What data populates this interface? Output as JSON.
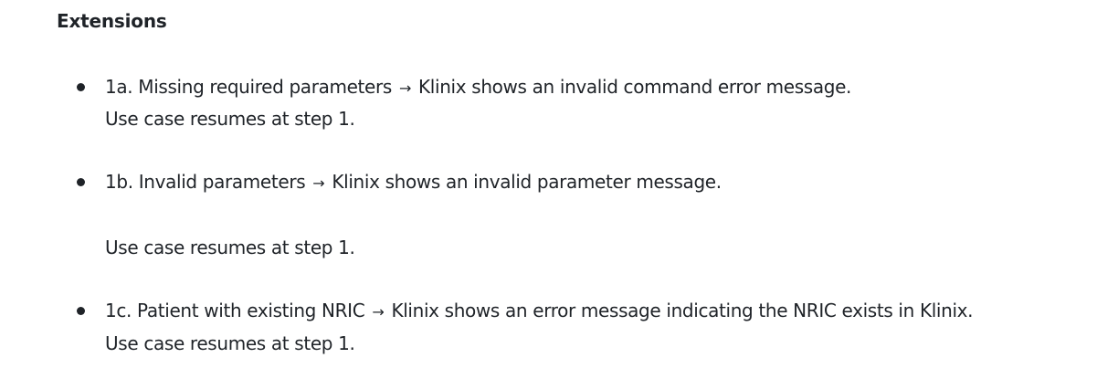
{
  "section": {
    "heading": "Extensions"
  },
  "extensions": [
    {
      "id": "1a",
      "lead": "1a. Missing required parameters",
      "arrow": "→",
      "result": "Klinix shows an invalid command error message.",
      "resume": "Use case resumes at step 1."
    },
    {
      "id": "1b",
      "lead": "1b. Invalid parameters",
      "arrow": "→",
      "result": "Klinix shows an invalid parameter message.",
      "resume": "Use case resumes at step 1."
    },
    {
      "id": "1c",
      "lead": "1c. Patient with existing NRIC",
      "arrow": "→",
      "result": "Klinix shows an error message indicating the NRIC exists in Klinix.",
      "resume": "Use case resumes at step 1."
    }
  ]
}
